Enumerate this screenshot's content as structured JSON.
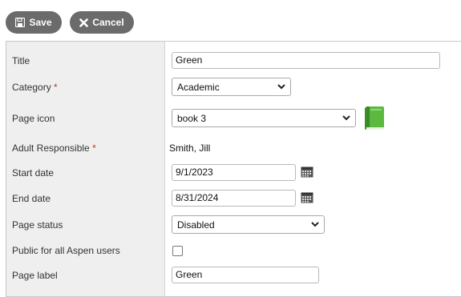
{
  "toolbar": {
    "save_label": "Save",
    "cancel_label": "Cancel",
    "save_icon": "floppy-disk-icon",
    "cancel_icon": "x-icon"
  },
  "form": {
    "title": {
      "label": "Title",
      "value": "Green"
    },
    "category": {
      "label": "Category",
      "required_mark": "*",
      "value": "Academic"
    },
    "page_icon": {
      "label": "Page icon",
      "value": "book 3",
      "preview_icon": "green-book-icon"
    },
    "adult_responsible": {
      "label": "Adult Responsible",
      "required_mark": "*",
      "value": "Smith, Jill"
    },
    "start_date": {
      "label": "Start date",
      "value": "9/1/2023",
      "picker_icon": "calendar-icon"
    },
    "end_date": {
      "label": "End date",
      "value": "8/31/2024",
      "picker_icon": "calendar-icon"
    },
    "page_status": {
      "label": "Page status",
      "value": "Disabled"
    },
    "public": {
      "label": "Public for all Aspen users",
      "checked": false
    },
    "page_label": {
      "label": "Page label",
      "value": "Green"
    }
  },
  "colors": {
    "button_bg": "#6b6b6b",
    "label_column_bg": "#efefef",
    "required": "#c0392b",
    "book_green": "#4caf3a"
  }
}
